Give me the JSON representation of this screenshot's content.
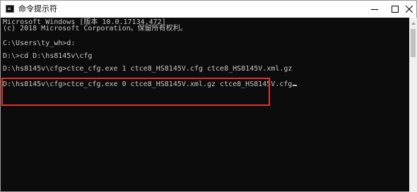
{
  "window": {
    "title": "命令提示符"
  },
  "console": {
    "lines": [
      "Microsoft Windows [版本 10.0.17134.472]",
      "(c) 2018 Microsoft Corporation。保留所有权利。",
      "",
      "C:\\Users\\ty_wh>d:",
      "",
      "D:\\>cd D:\\hs8145v\\cfg",
      "",
      "D:\\hs8145v\\cfg>ctce_cfg.exe 1 ctce8_HS8145V.cfg ctce8_HS8145V.xml.gz",
      "",
      "D:\\hs8145v\\cfg>ctce_cfg.exe 0 ctce8_HS8145V.xml.gz ctce8_HS8145V.cfg"
    ]
  },
  "colors": {
    "console_bg": "#0c0c0c",
    "console_text": "#c8c8c8",
    "highlight_border": "#e0332b"
  },
  "icons": {
    "app": "cmd-icon",
    "minimize": "minimize-icon",
    "maximize": "maximize-icon",
    "close": "close-icon"
  }
}
